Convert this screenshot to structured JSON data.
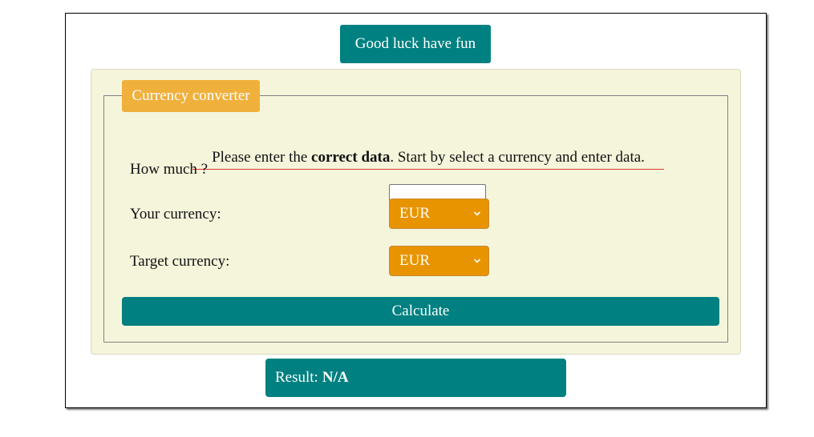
{
  "banner": {
    "text": "Good luck have fun"
  },
  "converter": {
    "legend": "Currency converter",
    "intro": {
      "before": "Please enter the ",
      "bold": "correct data",
      "after": ". Start by select a currency and enter data."
    },
    "amount": {
      "label": "How much ?",
      "value": ""
    },
    "your_currency": {
      "label": "Your currency:",
      "selected": "EUR"
    },
    "target_currency": {
      "label": "Target currency:",
      "selected": "EUR"
    },
    "calculate_label": "Calculate"
  },
  "result": {
    "label": "Result:",
    "value": "N/A"
  },
  "icons": {
    "dropdown": "chevron-down-icon"
  },
  "colors": {
    "teal": "#008080",
    "legend_orange": "#f0b03c",
    "select_orange": "#e89400",
    "panel_bg": "#f5f5dc",
    "underline_red": "#d9342b"
  }
}
